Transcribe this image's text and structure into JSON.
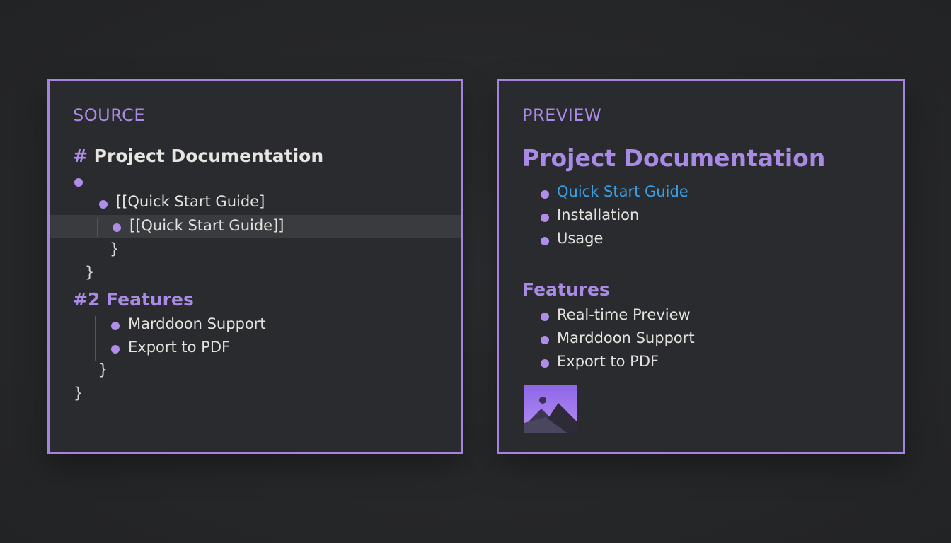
{
  "source": {
    "title": "SOURCE",
    "heading_hash": "#",
    "heading_text": "Project Documentation",
    "line_guide_1": "[[Quick Start Guide]",
    "line_guide_2": "[[Quick Start Guide]]",
    "brace_1": "}",
    "brace_2": "}",
    "features_heading": "#2 Features",
    "feature_1": "Marddoon Support",
    "feature_2": "Export to PDF",
    "brace_3": "}",
    "brace_4": "}"
  },
  "preview": {
    "title": "PREVIEW",
    "heading": "Project Documentation",
    "items": [
      "Quick Start Guide",
      "Installation",
      "Usage"
    ],
    "features_heading": "Features",
    "features": [
      "Real-time Preview",
      "Marddoon Support",
      "Export to PDF"
    ],
    "image_icon": "image-thumbnail-icon"
  },
  "colors": {
    "accent": "#a783e0",
    "link": "#3aa0e6",
    "background": "#262729"
  }
}
